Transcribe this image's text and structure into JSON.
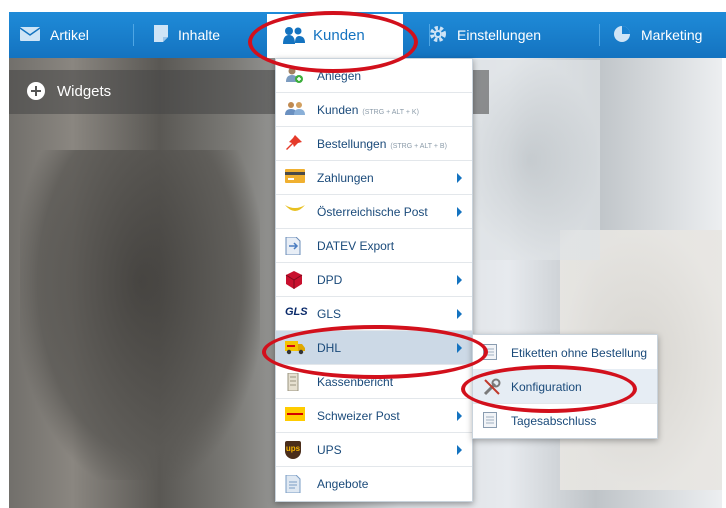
{
  "nav": {
    "items": [
      {
        "label": "Artikel",
        "icon": "mail-icon"
      },
      {
        "label": "Inhalte",
        "icon": "document-icon"
      },
      {
        "label": "Kunden",
        "icon": "users-icon"
      },
      {
        "label": "Einstellungen",
        "icon": "gear-icon"
      },
      {
        "label": "Marketing",
        "icon": "pie-chart-icon"
      }
    ]
  },
  "widgets": {
    "label": "Widgets"
  },
  "menu": {
    "items": [
      {
        "label": "Anlegen"
      },
      {
        "label": "Kunden",
        "hint": "(STRG + ALT + K)"
      },
      {
        "label": "Bestellungen",
        "hint": "(STRG + ALT + B)"
      },
      {
        "label": "Zahlungen"
      },
      {
        "label": "Österreichische Post"
      },
      {
        "label": "DATEV Export"
      },
      {
        "label": "DPD"
      },
      {
        "label": "GLS",
        "icon_text": "GLS"
      },
      {
        "label": "DHL"
      },
      {
        "label": "Kassenbericht"
      },
      {
        "label": "Schweizer Post"
      },
      {
        "label": "UPS",
        "icon_text": "ups"
      },
      {
        "label": "Angebote"
      }
    ]
  },
  "submenu": {
    "items": [
      {
        "label": "Etiketten ohne Bestellung"
      },
      {
        "label": "Konfiguration"
      },
      {
        "label": "Tagesabschluss"
      }
    ]
  },
  "colors": {
    "nav": "#1a7fcf",
    "highlight_ring": "#d2101c",
    "link": "#1a4a7a"
  }
}
